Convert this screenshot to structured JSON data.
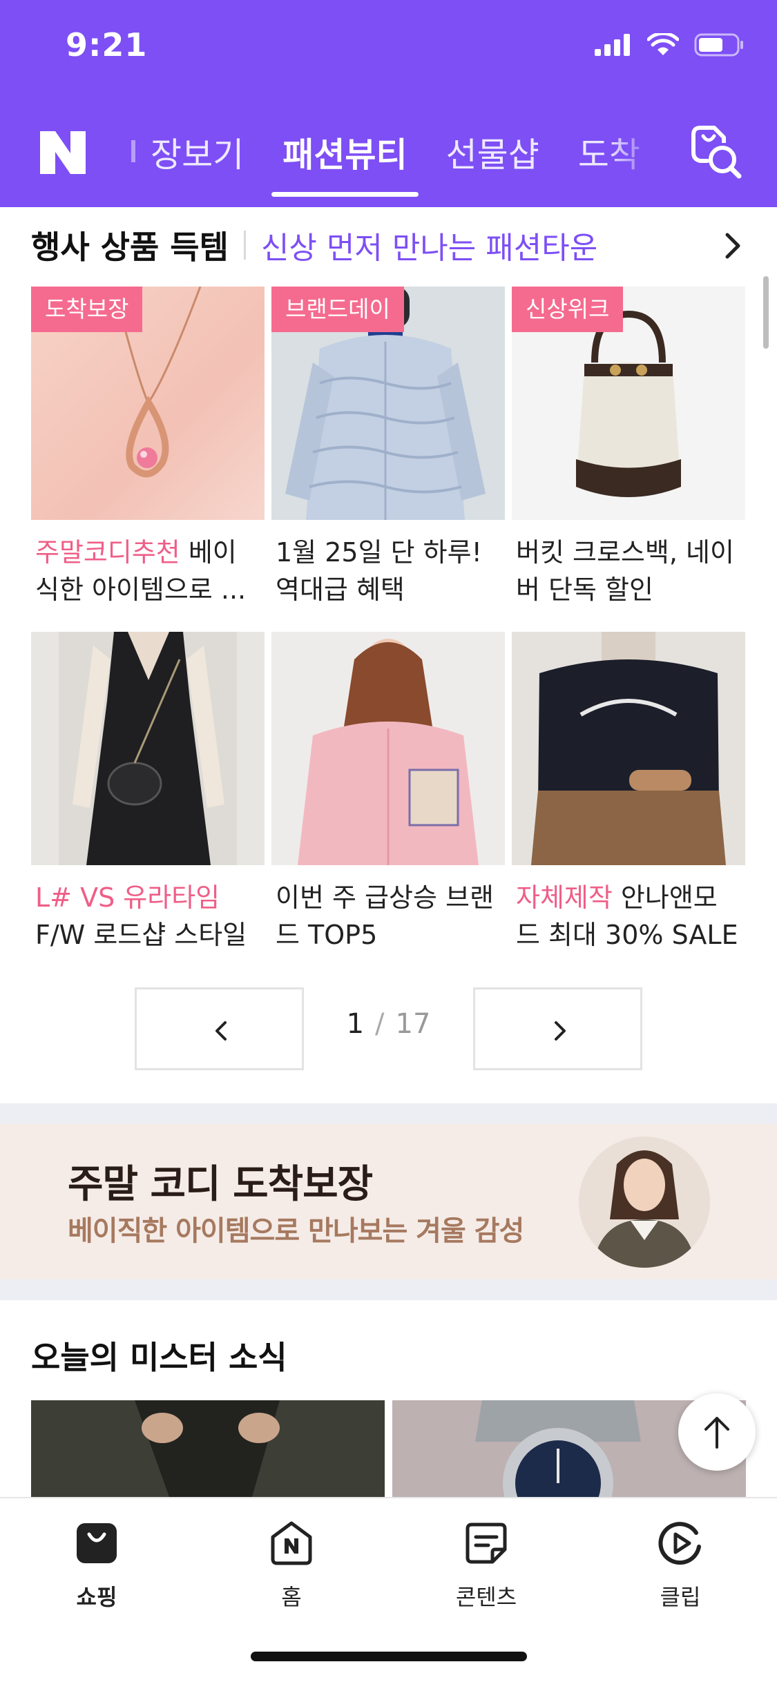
{
  "status": {
    "time": "9:21"
  },
  "header": {
    "logo_letter": "N",
    "tabs": [
      {
        "label": "장보기"
      },
      {
        "label": "패션뷰티",
        "active": true
      },
      {
        "label": "선물샵"
      },
      {
        "label": "도착"
      }
    ],
    "search_icon": "shopping-search-icon",
    "brand_color": "#7d4ff5"
  },
  "section1": {
    "title": "행사 상품 득템",
    "subtitle": "신상 먼저 만나는 패션타운",
    "arrow_icon": "chevron-right-icon",
    "items": [
      {
        "badge": "도착보장",
        "highlight": "주말코디추천",
        "text": " 베이식한 아이템으로 ...",
        "image": "rose-gold-necklace"
      },
      {
        "badge": "브랜드데이",
        "highlight": "",
        "text": "1월 25일 단 하루! 역대급 혜택",
        "image": "light-blue-quilted-jacket"
      },
      {
        "badge": "신상위크",
        "highlight": "",
        "text": "버킷 크로스백, 네이버 단독 할인",
        "image": "bucket-crossbody-bag"
      },
      {
        "badge": "",
        "highlight": "L# VS 유라타임",
        "text": " F/W 로드샵 스타일 ...",
        "image": "black-dress-with-bag"
      },
      {
        "badge": "",
        "highlight": "",
        "text": "이번 주 급상승 브랜드 TOP5",
        "image": "pink-shirt-model"
      },
      {
        "badge": "",
        "highlight": "자체제작",
        "text": " 안나앤모드 최대 30% SALE",
        "image": "santa-monica-sweatshirt"
      }
    ],
    "accent_color": "#ef5e87"
  },
  "pager": {
    "current": "1",
    "separator": "/",
    "total": "17"
  },
  "banner": {
    "title": "주말 코디 도착보장",
    "subtitle": "베이직한 아이템으로 만나보는 겨울 감성"
  },
  "section2": {
    "title": "오늘의 미스터 소식"
  },
  "bottom_nav": [
    {
      "label": "쇼핑",
      "icon": "shopping-bag-icon",
      "active": true
    },
    {
      "label": "홈",
      "icon": "naver-home-icon"
    },
    {
      "label": "콘텐츠",
      "icon": "contents-icon"
    },
    {
      "label": "클립",
      "icon": "clip-play-icon"
    }
  ]
}
